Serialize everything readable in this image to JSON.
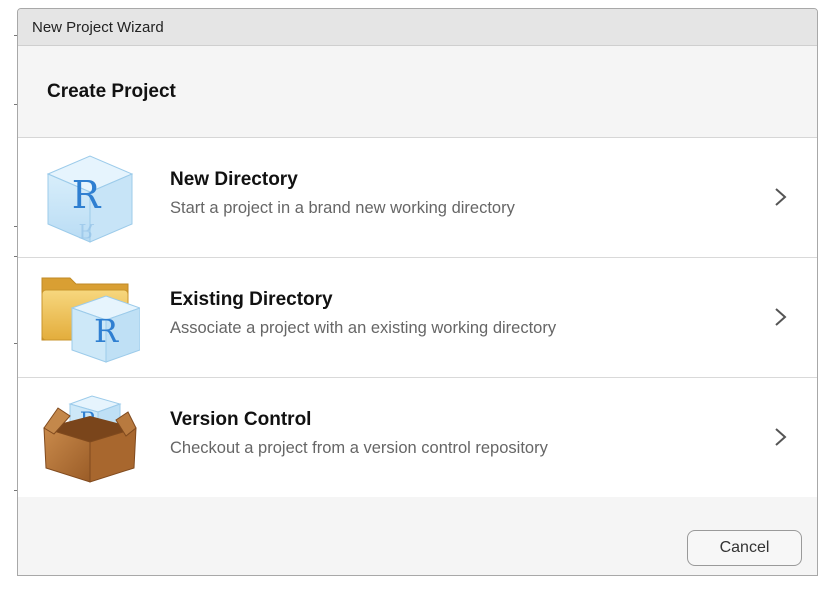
{
  "window": {
    "title": "New Project Wizard"
  },
  "header": {
    "title": "Create Project"
  },
  "options": [
    {
      "title": "New Directory",
      "description": "Start a project in a brand new working directory",
      "icon": "r-cube-icon"
    },
    {
      "title": "Existing Directory",
      "description": "Associate a project with an existing working directory",
      "icon": "folder-r-cube-icon"
    },
    {
      "title": "Version Control",
      "description": "Checkout a project from a version control repository",
      "icon": "box-r-cube-icon"
    }
  ],
  "footer": {
    "cancel_label": "Cancel"
  },
  "colors": {
    "cube_blue": "#2f7fd1",
    "folder_yellow": "#e9b94a",
    "box_brown": "#b06e34"
  }
}
